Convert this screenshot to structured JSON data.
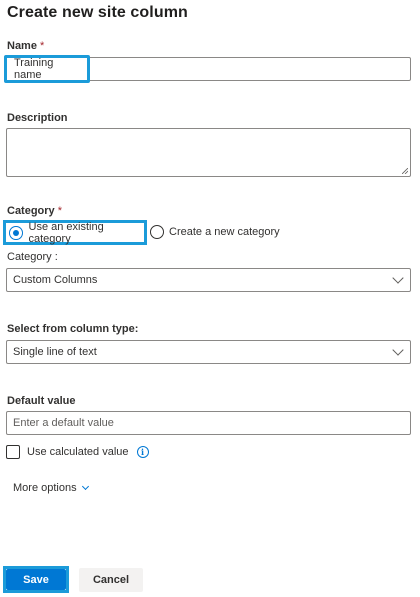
{
  "panel": {
    "title": "Create new site column"
  },
  "name_field": {
    "label": "Name",
    "required_mark": "*",
    "value": "Training name"
  },
  "description_field": {
    "label": "Description",
    "value": ""
  },
  "category": {
    "label": "Category",
    "required_mark": "*",
    "options": [
      {
        "label": "Use an existing category",
        "selected": true
      },
      {
        "label": "Create a new category",
        "selected": false
      }
    ],
    "sub_label": "Category :",
    "selected_value": "Custom Columns"
  },
  "column_type": {
    "label": "Select from column type:",
    "selected_value": "Single line of text"
  },
  "default_value": {
    "label": "Default value",
    "placeholder": "Enter a default value"
  },
  "calculated": {
    "label": "Use calculated value",
    "checked": false,
    "info_icon": "info-icon"
  },
  "more_options": {
    "label": "More options"
  },
  "buttons": {
    "save": "Save",
    "cancel": "Cancel"
  },
  "colors": {
    "accent": "#0078d4",
    "highlight": "#1b9bd9",
    "required": "#a4262c"
  }
}
